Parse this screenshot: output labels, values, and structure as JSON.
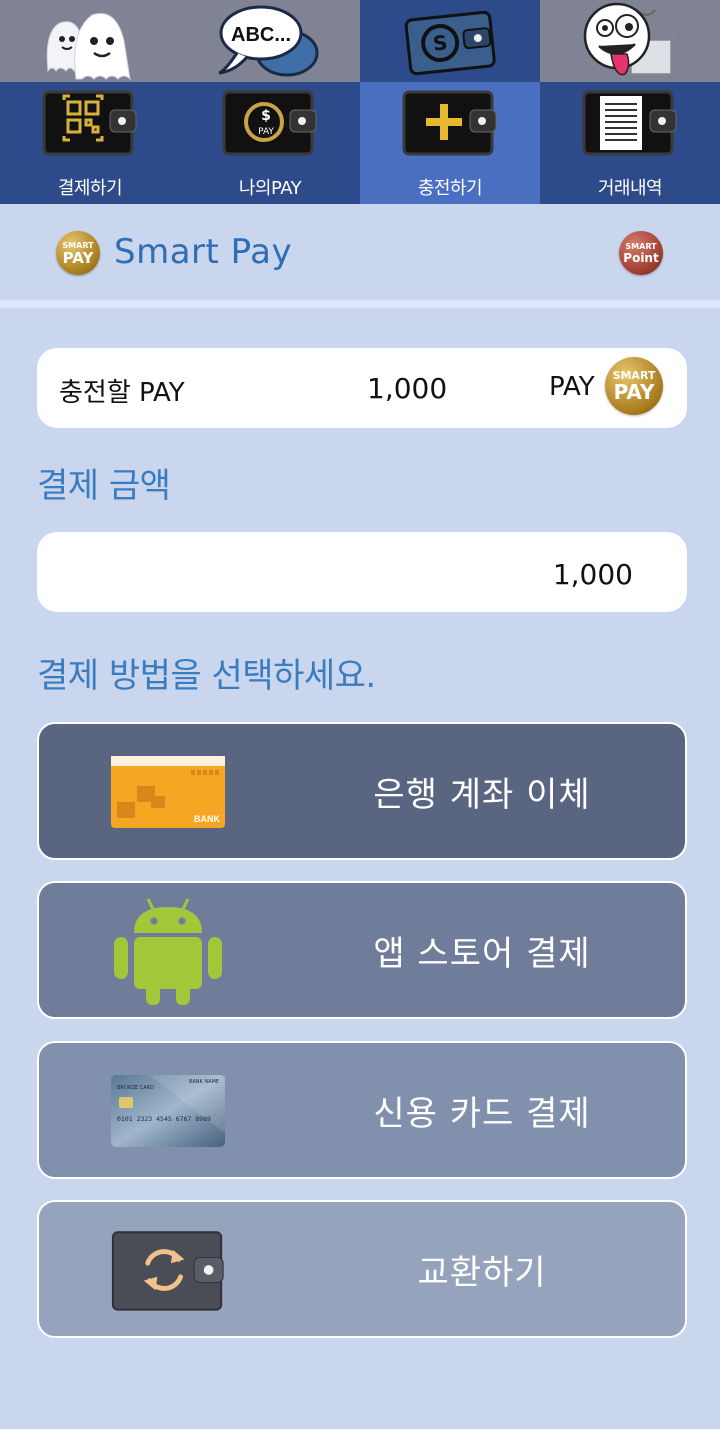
{
  "top_icons": [
    {
      "name": "ghosts-icon"
    },
    {
      "name": "speech-bubble-icon",
      "text": "ABC..."
    },
    {
      "name": "smart-wallet-icon"
    },
    {
      "name": "silly-face-icon"
    }
  ],
  "tabs": [
    {
      "label": "결제하기",
      "icon": "qr-wallet-icon",
      "active": false
    },
    {
      "label": "나의PAY",
      "icon": "pay-coin-wallet-icon",
      "active": false
    },
    {
      "label": "충전하기",
      "icon": "plus-wallet-icon",
      "active": true
    },
    {
      "label": "거래내역",
      "icon": "document-wallet-icon",
      "active": false
    }
  ],
  "brand": {
    "title": "Smart Pay",
    "coin_top": "SMART",
    "coin_bottom": "PAY",
    "point_top": "SMART",
    "point_bottom": "Point"
  },
  "charge": {
    "label": "충전할 PAY",
    "amount": "1,000",
    "unit": "PAY",
    "coin_top": "SMART",
    "coin_bottom": "PAY"
  },
  "payment_amount": {
    "title": "결제 금액",
    "value": "1,000"
  },
  "methods": {
    "title": "결제 방법을 선택하세요.",
    "items": [
      {
        "label": "은행 계좌 이체",
        "icon": "bank-card-icon",
        "icon_text": "BANK",
        "bg": "#5a6582"
      },
      {
        "label": "앱 스토어 결제",
        "icon": "android-icon",
        "bg": "#6f7c9a"
      },
      {
        "label": "신용 카드 결제",
        "icon": "credit-card-icon",
        "card_number": "0101 2323 4545 6767 8989",
        "card_brand": "BRONZE CARD",
        "card_bank": "BANK NAME",
        "bg": "#8190ad"
      },
      {
        "label": "교환하기",
        "icon": "exchange-wallet-icon",
        "bg": "#95a3bd"
      }
    ]
  },
  "colors": {
    "accent": "#2f6db5",
    "nav_active": "#4b6fc0",
    "nav": "#2d4a8a",
    "background": "#c9d6ee"
  }
}
